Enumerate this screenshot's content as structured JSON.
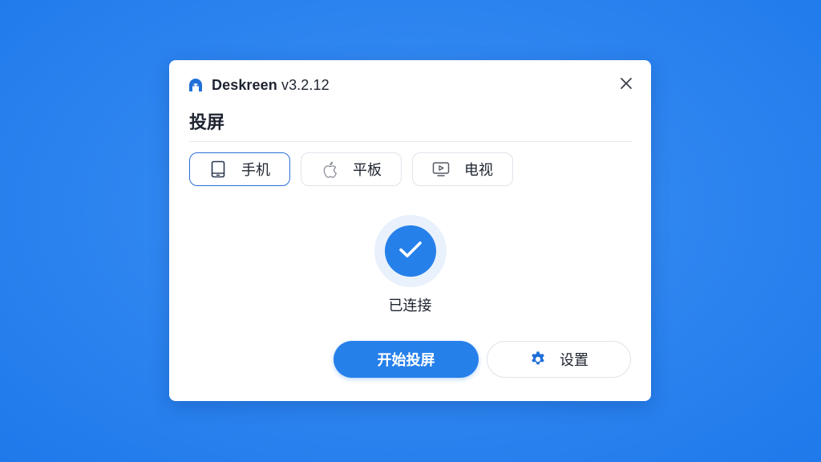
{
  "window": {
    "app_name": "Deskreen",
    "app_version": "v3.2.12",
    "logo_icon": "deskreen-logo-icon",
    "close_icon": "close-icon"
  },
  "section": {
    "title": "投屏"
  },
  "tabs": [
    {
      "label": "手机",
      "icon": "tablet-icon",
      "active": true
    },
    {
      "label": "平板",
      "icon": "apple-icon",
      "active": false
    },
    {
      "label": "电视",
      "icon": "tv-icon",
      "active": false
    }
  ],
  "status": {
    "text": "已连接",
    "icon": "check-icon"
  },
  "actions": {
    "primary_label": "开始投屏",
    "secondary_label": "设置",
    "secondary_icon": "gear-icon"
  },
  "colors": {
    "accent": "#2680ea",
    "background": "#2f86f0",
    "active_tab_border": "#2a6fd6"
  }
}
